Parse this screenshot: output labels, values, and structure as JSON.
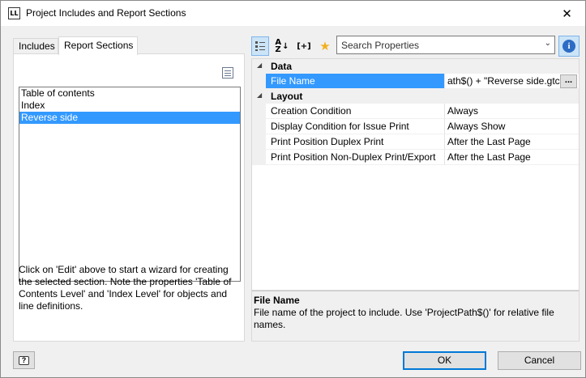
{
  "window": {
    "app_icon_text": "LL",
    "title": "Project Includes and Report Sections",
    "close_glyph": "✕"
  },
  "left": {
    "tabs": [
      {
        "label": "Includes",
        "active": false
      },
      {
        "label": "Report Sections",
        "active": true
      }
    ],
    "list_items": [
      {
        "label": "Table of contents",
        "selected": false
      },
      {
        "label": "Index",
        "selected": false
      },
      {
        "label": "Reverse side",
        "selected": true
      }
    ],
    "help_text": "Click on 'Edit' above to start a wizard for creating the selected section. Note the properties 'Table of Contents Level' and 'Index Level' for objects and line definitions."
  },
  "toolbar": {
    "sort_glyph_top": "A",
    "sort_glyph_bottom": "Z",
    "expand_glyph": "[+]",
    "favorite_glyph": "★",
    "search_placeholder": "Search Properties",
    "dropdown_glyph": "⌄",
    "info_glyph": "i"
  },
  "properties": {
    "categories": [
      {
        "label": "Data",
        "arrow": "◢",
        "rows": [
          {
            "name": "File Name",
            "value": "ath$() + \"Reverse side.gtc\"",
            "selected": true,
            "button": "..."
          }
        ]
      },
      {
        "label": "Layout",
        "arrow": "◢",
        "rows": [
          {
            "name": "Creation Condition",
            "value": "Always"
          },
          {
            "name": "Display Condition for Issue Print",
            "value": "Always Show"
          },
          {
            "name": "Print Position Duplex Print",
            "value": "After the Last Page"
          },
          {
            "name": "Print Position Non-Duplex Print/Export",
            "value": "After the Last Page"
          }
        ]
      }
    ]
  },
  "description": {
    "title": "File Name",
    "text": "File name of the project to include. Use 'ProjectPath$()' for relative file names."
  },
  "footer": {
    "help_glyph": "?",
    "ok_label": "OK",
    "cancel_label": "Cancel"
  }
}
